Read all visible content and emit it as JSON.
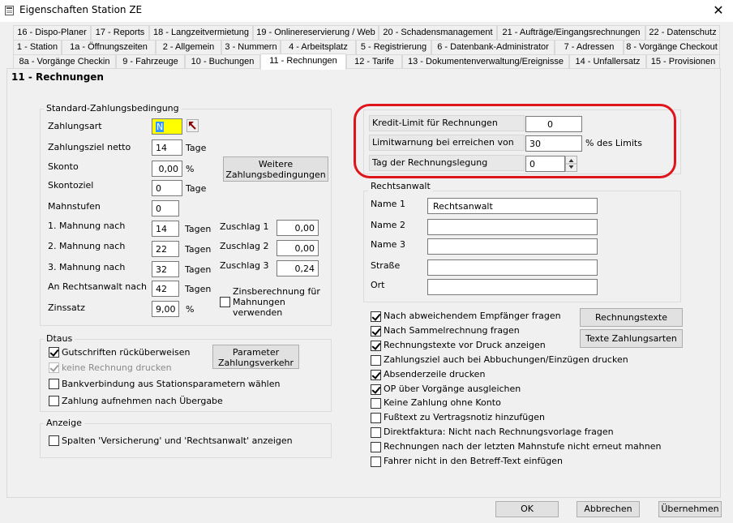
{
  "window": {
    "title": "Eigenschaften Station ZE",
    "close": "✕"
  },
  "tabs": {
    "row1": [
      "16 - Dispo-Planer",
      "17 - Reports",
      "18 - Langzeitvermietung",
      "19 - Onlinereservierung / Web",
      "20 - Schadensmanagement",
      "21 - Aufträge/Eingangsrechnungen",
      "22 - Datenschutz"
    ],
    "row2": [
      "1 - Station",
      "1a - Öffnungszeiten",
      "2 - Allgemein",
      "3 - Nummern",
      "4 - Arbeitsplatz",
      "5 - Registrierung",
      "6 - Datenbank-Administrator",
      "7 - Adressen",
      "8 - Vorgänge Checkout"
    ],
    "row3": [
      "8a - Vorgänge Checkin",
      "9 - Fahrzeuge",
      "10 - Buchungen",
      "11 - Rechnungen",
      "12 - Tarife",
      "13 - Dokumentenverwaltung/Ereignisse",
      "14 - Unfallersatz",
      "15 - Provisionen"
    ]
  },
  "page": {
    "title": "11 - Rechnungen"
  },
  "standard": {
    "title": "Standard-Zahlungsbedingung",
    "zahlungsart_label": "Zahlungsart",
    "zahlungsart_value": "N",
    "zahlungsziel_label": "Zahlungsziel netto",
    "zahlungsziel_value": "14",
    "tage": "Tage",
    "skonto_label": "Skonto",
    "skonto_value": "0,00",
    "percent": "%",
    "skontoziel_label": "Skontoziel",
    "skontoziel_value": "0",
    "weitere_button": "Weitere Zahlungsbedingungen",
    "mahnstufen_label": "Mahnstufen",
    "mahnstufen_value": "0",
    "mahnung1_label": "1. Mahnung nach",
    "mahnung1_value": "14",
    "mahnung2_label": "2. Mahnung nach",
    "mahnung2_value": "22",
    "mahnung3_label": "3. Mahnung nach",
    "mahnung3_value": "32",
    "rechtsanwalt_label": "An Rechtsanwalt nach",
    "rechtsanwalt_value": "42",
    "tagen": "Tagen",
    "zuschlag1_label": "Zuschlag 1",
    "zuschlag1_value": "0,00",
    "zuschlag2_label": "Zuschlag 2",
    "zuschlag2_value": "0,00",
    "zuschlag3_label": "Zuschlag 3",
    "zuschlag3_value": "0,24",
    "zinssatz_label": "Zinssatz",
    "zinssatz_value": "9,00",
    "zinsberechnung_label": "Zinsberechnung für Mahnungen verwenden"
  },
  "dtaus": {
    "title": "Dtaus",
    "gutschriften": "Gutschriften rücküberweisen",
    "keine_rechnung": "keine Rechnung drucken",
    "parameter_button": "Parameter Zahlungsverkehr",
    "bankverbindung": "Bankverbindung aus Stationsparametern wählen",
    "zahlung_aufnehmen": "Zahlung aufnehmen nach Übergabe"
  },
  "anzeige": {
    "title": "Anzeige",
    "spalten": "Spalten 'Versicherung' und 'Rechtsanwalt' anzeigen"
  },
  "kredit": {
    "limit_label": "Kredit-Limit für Rechnungen",
    "limit_value": "0",
    "warnung_label": "Limitwarnung bei erreichen von",
    "warnung_value": "30",
    "warnung_suffix": "% des Limits",
    "tag_label": "Tag der Rechnungslegung",
    "tag_value": "0"
  },
  "rechtsanwalt": {
    "title": "Rechtsanwalt",
    "name1_label": "Name 1",
    "name1_value": "Rechtsanwalt",
    "name2_label": "Name 2",
    "name2_value": "",
    "name3_label": "Name 3",
    "name3_value": "",
    "strasse_label": "Straße",
    "strasse_value": "",
    "ort_label": "Ort",
    "ort_value": ""
  },
  "options": [
    {
      "label": "Nach abweichendem Empfänger fragen",
      "checked": true
    },
    {
      "label": "Nach Sammelrechnung fragen",
      "checked": true
    },
    {
      "label": "Rechnungstexte vor Druck anzeigen",
      "checked": true
    },
    {
      "label": "Zahlungsziel auch bei Abbuchungen/Einzügen drucken",
      "checked": false
    },
    {
      "label": "Absenderzeile drucken",
      "checked": true
    },
    {
      "label": "OP über Vorgänge ausgleichen",
      "checked": true
    },
    {
      "label": "Keine Zahlung ohne Konto",
      "checked": false
    },
    {
      "label": "Fußtext zu Vertragsnotiz hinzufügen",
      "checked": false
    },
    {
      "label": "Direktfaktura: Nicht nach Rechnungsvorlage fragen",
      "checked": false
    },
    {
      "label": "Rechnungen nach der letzten Mahnstufe nicht erneut mahnen",
      "checked": false
    },
    {
      "label": "Fahrer nicht in den Betreff-Text einfügen",
      "checked": false
    }
  ],
  "buttons": {
    "rechnungstexte": "Rechnungstexte",
    "texte_zahlungsarten": "Texte Zahlungsarten",
    "ok": "OK",
    "abbrechen": "Abbrechen",
    "uebernehmen": "Übernehmen"
  },
  "colors": {
    "highlight_field": "#ffff00",
    "annotation_ring": "#e0141b"
  },
  "icons": {
    "arrow_button": "arrow-up-left-icon",
    "spinner": "spinner-icon",
    "app": "app-window-icon"
  }
}
